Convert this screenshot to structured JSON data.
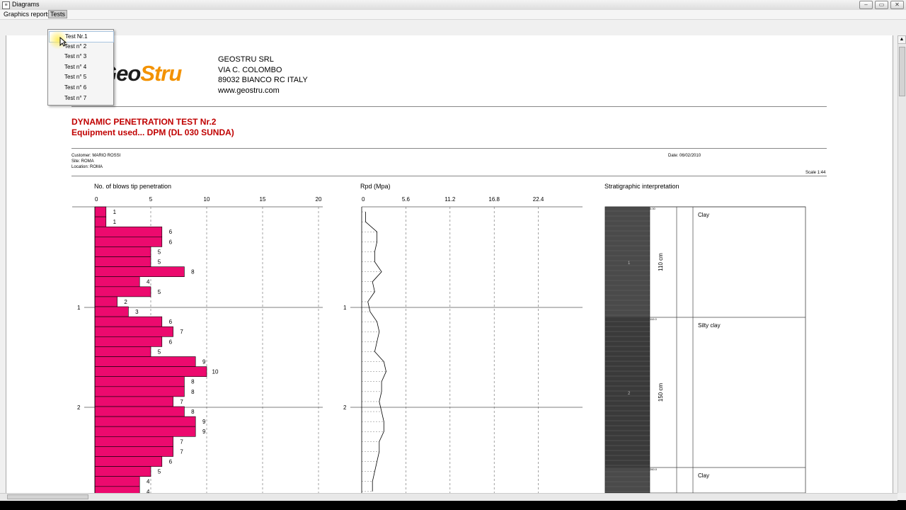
{
  "window": {
    "title": "Diagrams",
    "buttons": [
      "minimize",
      "maximize",
      "close"
    ]
  },
  "menubar": {
    "items": [
      {
        "label": "Graphics reports"
      },
      {
        "label": "Tests"
      }
    ]
  },
  "dropdown": {
    "items": [
      "Test Nr.1",
      "Test n° 2",
      "Test n° 3",
      "Test n° 4",
      "Test n° 5",
      "Test n° 6",
      "Test n° 7"
    ],
    "hovered_index": 0
  },
  "report": {
    "logo": {
      "part1": "Geo",
      "part2": "Stru"
    },
    "company": {
      "name": "GEOSTRU SRL",
      "address": "VIA C. COLOMBO",
      "city": "89032 BIANCO RC ITALY",
      "web": "www.geostru.com"
    },
    "title": "DYNAMIC PENETRATION TEST Nr.2",
    "equipment": "Equipment used... DPM (DL 030 SUNDA)",
    "customer": "Customer: MARIO ROSSI",
    "site": "Site: ROMA",
    "location": "Location: ROMA",
    "date": "Date: 06/02/2010",
    "scale": "Scale 1:44",
    "blows_header": "No. of blows tip penetration",
    "rpd_header": "Rpd (Mpa)",
    "strat_header": "Stratigraphic interpretation"
  },
  "chart_data": [
    {
      "type": "bar",
      "title": "No. of blows tip penetration",
      "x_ticks": [
        "0",
        "5",
        "10",
        "15",
        "20"
      ],
      "xlim": [
        0,
        20
      ],
      "depth_ticks": [
        "1",
        "2"
      ],
      "values": [
        1,
        1,
        6,
        6,
        5,
        5,
        8,
        4,
        5,
        2,
        3,
        6,
        7,
        6,
        5,
        9,
        10,
        8,
        8,
        7,
        8,
        9,
        9,
        7,
        7,
        6,
        5,
        4,
        4
      ],
      "bar_color": "#ec0a6e",
      "grid": "dashed vertical"
    },
    {
      "type": "line",
      "title": "Rpd (Mpa)",
      "x_ticks": [
        "0",
        "5.6",
        "11.2",
        "16.8",
        "22.4"
      ],
      "xlim": [
        0,
        28
      ],
      "depth_ticks": [
        "1",
        "2"
      ],
      "grid": "dashed vertical"
    },
    {
      "type": "table",
      "title": "Stratigraphic interpretation",
      "layers": [
        {
          "description": "Clay",
          "thickness": "110 cm",
          "number": "1",
          "top": "0.00",
          "bottom": "110.0",
          "fill": "#4a4a4a"
        },
        {
          "description": "Silty clay",
          "thickness": "150 cm",
          "number": "2",
          "top": "110.0",
          "bottom": "260.0",
          "fill": "#3a3a3a"
        },
        {
          "description": "Clay",
          "thickness": "",
          "number": "",
          "top": "260.0",
          "bottom": "",
          "fill": "#4a4a4a"
        }
      ]
    }
  ]
}
